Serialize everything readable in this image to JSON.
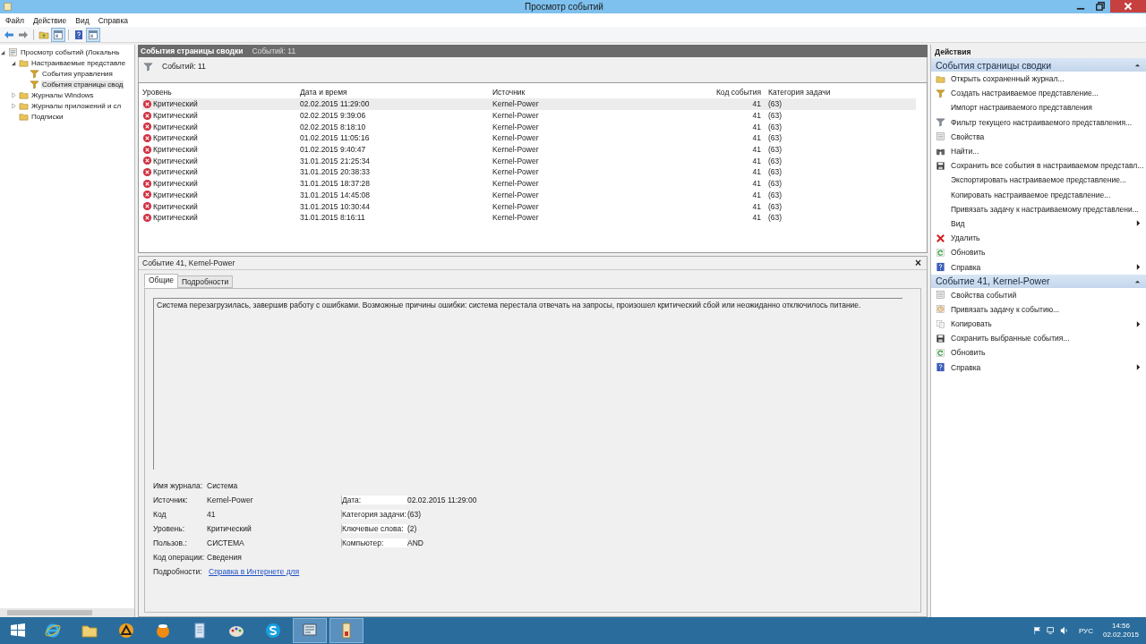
{
  "window": {
    "title": "Просмотр событий"
  },
  "menu": [
    "Файл",
    "Действие",
    "Вид",
    "Справка"
  ],
  "toolbar": [
    {
      "kind": "back"
    },
    {
      "kind": "forward"
    },
    {
      "kind": "sep"
    },
    {
      "kind": "folder"
    },
    {
      "kind": "panel"
    },
    {
      "kind": "sep"
    },
    {
      "kind": "help"
    },
    {
      "kind": "panel"
    }
  ],
  "tree": [
    {
      "label": "Просмотр событий (Локальнь",
      "kind": "viewer",
      "expanded": true,
      "selected": false,
      "children": [
        {
          "label": "Настраиваемые представле",
          "kind": "folder",
          "expanded": true,
          "selected": false,
          "children": [
            {
              "label": "События управления",
              "kind": "filter",
              "selected": false
            },
            {
              "label": "События страницы свод",
              "kind": "filter",
              "selected": true
            }
          ]
        },
        {
          "label": "Журналы Windows",
          "kind": "folder",
          "expanded": false,
          "selected": false
        },
        {
          "label": "Журналы приложений и сл",
          "kind": "folder",
          "expanded": false,
          "selected": false
        },
        {
          "label": "Подписки",
          "kind": "folder",
          "selected": false
        }
      ]
    }
  ],
  "summary": {
    "title": "События страницы сводки",
    "count": "Событий: 11",
    "filter_count": "Событий: 11"
  },
  "table": {
    "columns": [
      "Уровень",
      "Дата и время",
      "Источник",
      "Код события",
      "Категория задачи"
    ],
    "rows": [
      {
        "kind": "critical",
        "level": "Критический",
        "date": "02.02.2015 11:29:00",
        "source": "Kernel-Power",
        "code": "41",
        "category": "(63)",
        "selected": true
      },
      {
        "kind": "critical",
        "level": "Критический",
        "date": "02.02.2015 9:39:06",
        "source": "Kernel-Power",
        "code": "41",
        "category": "(63)",
        "selected": false
      },
      {
        "kind": "critical",
        "level": "Критический",
        "date": "02.02.2015 8:18:10",
        "source": "Kernel-Power",
        "code": "41",
        "category": "(63)",
        "selected": false
      },
      {
        "kind": "critical",
        "level": "Критический",
        "date": "01.02.2015 11:05:16",
        "source": "Kernel-Power",
        "code": "41",
        "category": "(63)",
        "selected": false
      },
      {
        "kind": "critical",
        "level": "Критический",
        "date": "01.02.2015 9:40:47",
        "source": "Kernel-Power",
        "code": "41",
        "category": "(63)",
        "selected": false
      },
      {
        "kind": "critical",
        "level": "Критический",
        "date": "31.01.2015 21:25:34",
        "source": "Kernel-Power",
        "code": "41",
        "category": "(63)",
        "selected": false
      },
      {
        "kind": "critical",
        "level": "Критический",
        "date": "31.01.2015 20:38:33",
        "source": "Kernel-Power",
        "code": "41",
        "category": "(63)",
        "selected": false
      },
      {
        "kind": "critical",
        "level": "Критический",
        "date": "31.01.2015 18:37:28",
        "source": "Kernel-Power",
        "code": "41",
        "category": "(63)",
        "selected": false
      },
      {
        "kind": "critical",
        "level": "Критический",
        "date": "31.01.2015 14:45:08",
        "source": "Kernel-Power",
        "code": "41",
        "category": "(63)",
        "selected": false
      },
      {
        "kind": "critical",
        "level": "Критический",
        "date": "31.01.2015 10:30:44",
        "source": "Kernel-Power",
        "code": "41",
        "category": "(63)",
        "selected": false
      },
      {
        "kind": "critical",
        "level": "Критический",
        "date": "31.01.2015 8:16:11",
        "source": "Kernel-Power",
        "code": "41",
        "category": "(63)",
        "selected": false
      }
    ]
  },
  "details": {
    "title": "Событие 41, Kernel-Power",
    "close": "×",
    "tabs": [
      {
        "label": "Общие",
        "selected": true
      },
      {
        "label": "Подробности",
        "selected": false
      }
    ],
    "description": "Система перезагрузилась, завершив работу с ошибками. Возможные причины ошибки: система перестала отвечать на запросы, произошел критический сбой или неожиданно отключилось питание.",
    "fields": [
      [
        {
          "label": "Имя журнала:",
          "value": "Система",
          "kind": "text"
        }
      ],
      [
        {
          "label": "Источник:",
          "value": "Kernel-Power",
          "kind": "text"
        },
        {
          "label": "Дата:",
          "value": "02.02.2015 11:29:00",
          "kind": "text"
        }
      ],
      [
        {
          "label": "Код",
          "value": "41",
          "kind": "text"
        },
        {
          "label": "Категория задачи:",
          "value": "(63)",
          "kind": "text"
        }
      ],
      [
        {
          "label": "Уровень:",
          "value": "Критический",
          "kind": "text"
        },
        {
          "label": "Ключевые слова:",
          "value": "(2)",
          "kind": "text"
        }
      ],
      [
        {
          "label": "Пользов.:",
          "value": "СИСТЕМА",
          "kind": "text"
        },
        {
          "label": "Компьютер:",
          "value": "AND",
          "kind": "text"
        }
      ],
      [
        {
          "label": "Код операции:",
          "value": "Сведения",
          "kind": "text"
        }
      ],
      [
        {
          "label": "Подробности:",
          "value": "Справка в Интернете для",
          "kind": "link"
        }
      ]
    ]
  },
  "actions": {
    "title": "Действия",
    "sections": [
      {
        "title": "События страницы сводки",
        "expanded": true,
        "items": [
          {
            "label": "Открыть сохраненный журнал...",
            "kind": "folder",
            "submenu": false
          },
          {
            "label": "Создать настраиваемое представление...",
            "kind": "filter",
            "submenu": false
          },
          {
            "label": "Импорт настраиваемого представления",
            "kind": "plain",
            "submenu": false
          },
          {
            "label": "Фильтр текущего настраиваемого представления...",
            "kind": "filter-gray",
            "submenu": false
          },
          {
            "label": "Свойства",
            "kind": "properties",
            "submenu": false
          },
          {
            "label": "Найти...",
            "kind": "find",
            "submenu": false
          },
          {
            "label": "Сохранить все события в настраиваемом представл...",
            "kind": "save",
            "submenu": false
          },
          {
            "label": "Экспортировать настраиваемое представление...",
            "kind": "plain",
            "submenu": false
          },
          {
            "label": "Копировать настраиваемое представление...",
            "kind": "plain",
            "submenu": false
          },
          {
            "label": "Привязать задачу к настраиваемому представлени...",
            "kind": "plain",
            "submenu": false
          },
          {
            "label": "Вид",
            "kind": "plain",
            "submenu": true
          },
          {
            "label": "Удалить",
            "kind": "delete",
            "submenu": false
          },
          {
            "label": "Обновить",
            "kind": "refresh",
            "submenu": false
          },
          {
            "label": "Справка",
            "kind": "help",
            "submenu": true
          }
        ]
      },
      {
        "title": "Событие 41, Kernel-Power",
        "expanded": true,
        "items": [
          {
            "label": "Свойства событий",
            "kind": "properties",
            "submenu": false
          },
          {
            "label": "Привязать задачу к событию...",
            "kind": "task",
            "submenu": false
          },
          {
            "label": "Копировать",
            "kind": "copy",
            "submenu": true
          },
          {
            "label": "Сохранить выбранные события...",
            "kind": "save",
            "submenu": false
          },
          {
            "label": "Обновить",
            "kind": "refresh",
            "submenu": false
          },
          {
            "label": "Справка",
            "kind": "help",
            "submenu": true
          }
        ]
      }
    ]
  },
  "taskbar": {
    "apps": [
      {
        "kind": "ie",
        "selected": false
      },
      {
        "kind": "folder",
        "selected": false
      },
      {
        "kind": "player",
        "selected": false
      },
      {
        "kind": "ball",
        "selected": false
      },
      {
        "kind": "doc",
        "selected": false
      },
      {
        "kind": "paint",
        "selected": false
      },
      {
        "kind": "skype",
        "selected": false
      },
      {
        "kind": "viewer",
        "selected": true
      },
      {
        "kind": "tool",
        "selected": true
      }
    ],
    "language": "РУС",
    "time": "14:56",
    "date": "02.02.2015"
  }
}
